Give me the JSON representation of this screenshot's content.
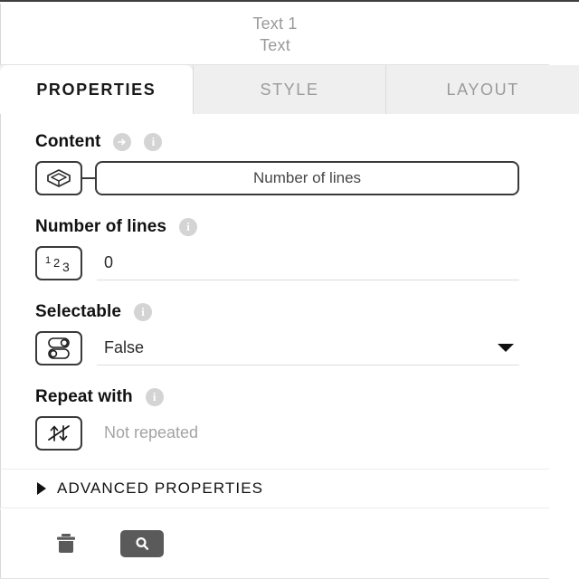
{
  "header": {
    "title": "Text 1",
    "subtitle": "Text"
  },
  "tabs": [
    {
      "label": "PROPERTIES",
      "active": true
    },
    {
      "label": "STYLE",
      "active": false
    },
    {
      "label": "LAYOUT",
      "active": false
    }
  ],
  "fields": {
    "content": {
      "label": "Content",
      "binding_icon": "arrow-right-circle-icon",
      "info_icon": "info-icon",
      "type_icon": "object-cube-icon",
      "value": "Number of lines"
    },
    "number_of_lines": {
      "label": "Number of lines",
      "info_icon": "info-icon",
      "type_icon": "number-123-icon",
      "value": "0",
      "digits": [
        "1",
        "2",
        "3"
      ]
    },
    "selectable": {
      "label": "Selectable",
      "info_icon": "info-icon",
      "type_icon": "boolean-toggle-icon",
      "value": "False",
      "dropdown_icon": "chevron-down-icon"
    },
    "repeat_with": {
      "label": "Repeat with",
      "info_icon": "info-icon",
      "type_icon": "no-repeat-icon",
      "value": "Not repeated"
    }
  },
  "advanced": {
    "label": "ADVANCED PROPERTIES",
    "expand_icon": "triangle-right-icon",
    "expanded": false
  },
  "footer": {
    "delete_icon": "trash-icon",
    "search_icon": "search-icon"
  },
  "colors": {
    "tabbar_bg": "#efefef",
    "active_tab_bg": "#ffffff",
    "muted_text": "#9a9a9a",
    "icon_gray": "#d4d4d4",
    "footer_button_bg": "#5a5a5a",
    "outline": "#3a3a3a"
  }
}
